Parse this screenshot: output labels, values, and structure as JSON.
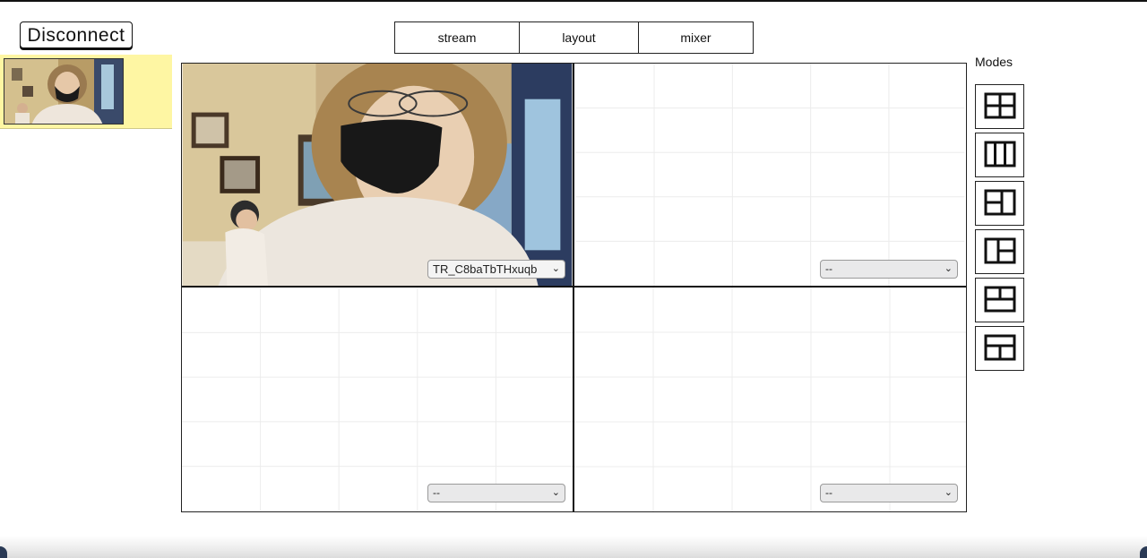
{
  "header": {
    "disconnect_label": "Disconnect",
    "tabs": [
      {
        "label": "stream"
      },
      {
        "label": "layout"
      },
      {
        "label": "mixer"
      }
    ]
  },
  "preview": {
    "highlight_color": "#fef6a3"
  },
  "grid": {
    "cells": [
      {
        "source": "TR_C8baTbTHxuqb",
        "has_video": true
      },
      {
        "source": "--",
        "has_video": false
      },
      {
        "source": "--",
        "has_video": false
      },
      {
        "source": "--",
        "has_video": false
      }
    ]
  },
  "modes": {
    "label": "Modes",
    "items": [
      {
        "icon": "grid-2x2-icon"
      },
      {
        "icon": "columns-3-icon"
      },
      {
        "icon": "split-left-icon"
      },
      {
        "icon": "split-right-icon"
      },
      {
        "icon": "split-top-icon"
      },
      {
        "icon": "split-bottom-icon"
      }
    ]
  },
  "colors": {
    "border": "#111111",
    "select_bg": "#e9e9ea",
    "grid_line": "#ececec"
  }
}
